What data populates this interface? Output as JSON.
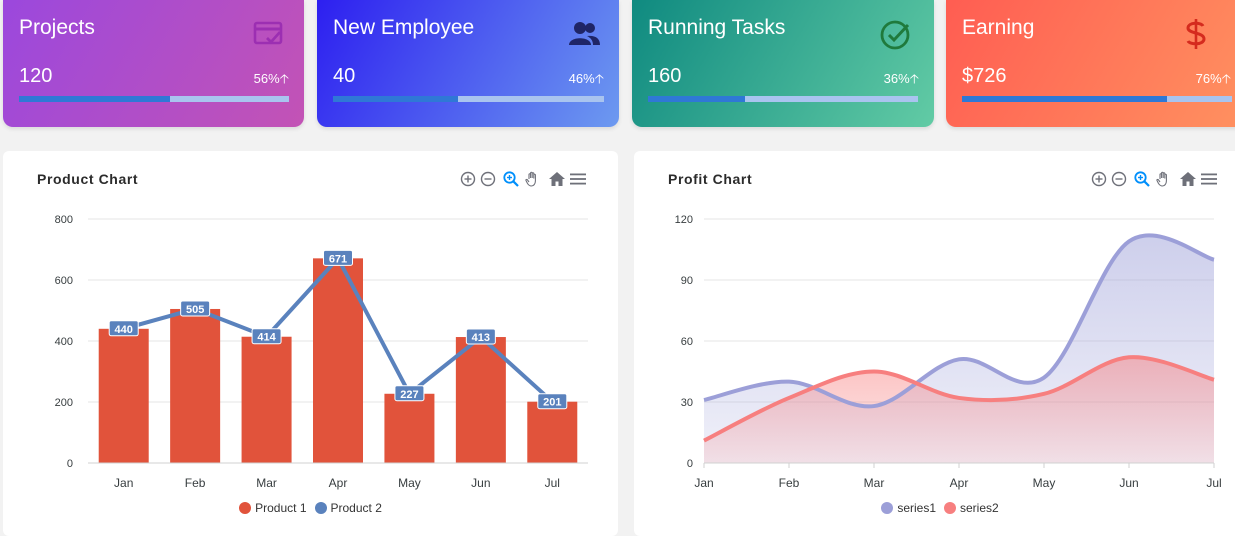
{
  "cards": [
    {
      "title": "Projects",
      "value": "120",
      "percent": "56%",
      "progress": 0.56,
      "icon": "card-check-icon",
      "icon_color": "#9c2fb2",
      "gradient": [
        "#9b48dd",
        "#c353b5"
      ]
    },
    {
      "title": "New Employee",
      "value": "40",
      "percent": "46%",
      "progress": 0.46,
      "icon": "users-icon",
      "icon_color": "#1f2566",
      "gradient": [
        "#2d1ff0",
        "#6d9af0"
      ]
    },
    {
      "title": "Running Tasks",
      "value": "160",
      "percent": "36%",
      "progress": 0.36,
      "icon": "check-circle-icon",
      "icon_color": "#1f7a3c",
      "gradient": [
        "#0f8a80",
        "#62cba5"
      ]
    },
    {
      "title": "Earning",
      "value": "$726",
      "percent": "76%",
      "progress": 0.76,
      "icon": "dollar-icon",
      "icon_color": "#d52b1e",
      "gradient": [
        "#ff5d52",
        "#ff9160"
      ]
    }
  ],
  "arrow_glyph": "🡡",
  "product_chart": {
    "title": "Product Chart",
    "toolbar": [
      "zoom-in-icon",
      "zoom-out-icon",
      "zoom-select-icon",
      "pan-hand-icon",
      "home-icon",
      "menu-icon"
    ]
  },
  "profit_chart": {
    "title": "Profit Chart",
    "toolbar": [
      "zoom-in-icon",
      "zoom-out-icon",
      "zoom-select-icon",
      "pan-hand-icon",
      "home-icon",
      "menu-icon"
    ]
  },
  "chart_data": [
    {
      "type": "bar",
      "title": "Product Chart",
      "categories": [
        "Jan",
        "Feb",
        "Mar",
        "Apr",
        "May",
        "Jun",
        "Jul"
      ],
      "ylim": [
        0,
        800
      ],
      "yticks": [
        "0",
        "200",
        "400",
        "600",
        "800"
      ],
      "grid": true,
      "legend": "bottom-center",
      "series": [
        {
          "name": "Product 1",
          "type": "bar",
          "color": "#e1533b",
          "values": [
            440,
            505,
            414,
            671,
            227,
            413,
            201
          ]
        },
        {
          "name": "Product 2",
          "type": "line",
          "color": "#5a82bd",
          "values": [
            440,
            505,
            414,
            671,
            227,
            413,
            201
          ],
          "data_labels": [
            "440",
            "505",
            "414",
            "671",
            "227",
            "413",
            "201"
          ]
        }
      ]
    },
    {
      "type": "area",
      "title": "Profit Chart",
      "categories": [
        "Jan",
        "Feb",
        "Mar",
        "Apr",
        "May",
        "Jun",
        "Jul"
      ],
      "ylim": [
        0,
        120
      ],
      "yticks": [
        "0",
        "30",
        "60",
        "90",
        "120"
      ],
      "grid": true,
      "legend": "bottom-center",
      "series": [
        {
          "name": "series1",
          "color": "#9c9fd8",
          "values": [
            31,
            40,
            28,
            51,
            42,
            109,
            100
          ]
        },
        {
          "name": "series2",
          "color": "#f77f7f",
          "values": [
            11,
            32,
            45,
            32,
            34,
            52,
            41
          ]
        }
      ]
    }
  ]
}
